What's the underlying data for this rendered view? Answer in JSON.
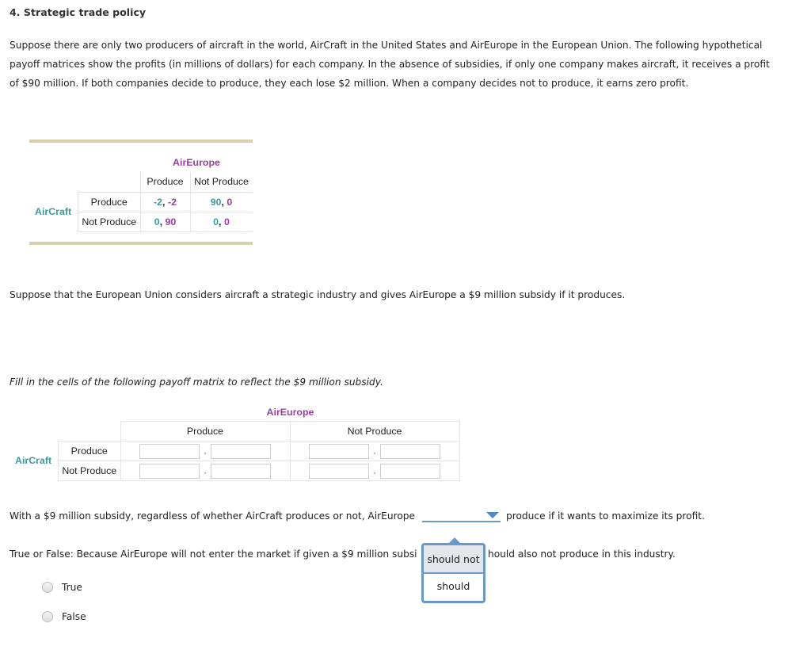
{
  "question": {
    "title": "4. Strategic trade policy",
    "intro": "Suppose there are only two producers of aircraft in the world, AirCraft in the United States and AirEurope in the European Union. The following hypothetical payoff matrices show the profits (in millions of dollars) for each company. In the absence of subsidies, if only one company makes aircraft, it receives a profit of $90 million. If both companies decide to produce, they each lose $2 million. When a company decides not to produce, it earns zero profit.",
    "subsidy_text": "Suppose that the European Union considers aircraft a strategic industry and gives AirEurope a $9 million subsidy if it produces.",
    "fill_instruction": "Fill in the cells of the following payoff matrix to reflect the $9 million subsidy."
  },
  "matrix1": {
    "col_player": "AirEurope",
    "row_player": "AirCraft",
    "col_headers": [
      "Produce",
      "Not Produce"
    ],
    "row_headers": [
      "Produce",
      "Not Produce"
    ],
    "cells": [
      [
        {
          "a": "-2",
          "b": "-2"
        },
        {
          "a": "90",
          "b": "0"
        }
      ],
      [
        {
          "a": "0",
          "b": "90"
        },
        {
          "a": "0",
          "b": "0"
        }
      ]
    ],
    "separator": ", "
  },
  "matrix2": {
    "col_player": "AirEurope",
    "row_player": "AirCraft",
    "col_headers": [
      "Produce",
      "Not Produce"
    ],
    "row_headers": [
      "Produce",
      "Not Produce"
    ],
    "inputs": [
      [
        {
          "a": "",
          "b": ""
        },
        {
          "a": "",
          "b": ""
        }
      ],
      [
        {
          "a": "",
          "b": ""
        },
        {
          "a": "",
          "b": ""
        }
      ]
    ],
    "separator": ","
  },
  "q2": {
    "before": "With a $9 million subsidy, regardless of whether AirCraft produces or not, AirEurope",
    "selected": "",
    "after": "produce if it wants to maximize its profit.",
    "options": [
      "should not",
      "should"
    ],
    "highlighted_option": "should not"
  },
  "q3": {
    "text_visible_left": "True or False: Because AirEurope will not enter the market if given a $9 million subsi",
    "text_visible_right": "hould also not produce in this industry.",
    "options": [
      "True",
      "False"
    ]
  },
  "colors": {
    "aircraft": "#3a9c9c",
    "aireurope": "#9a3e9d",
    "rule": "#d9cfa8",
    "dropdown": "#6a98c8",
    "highlight": "#e1e7ea"
  }
}
